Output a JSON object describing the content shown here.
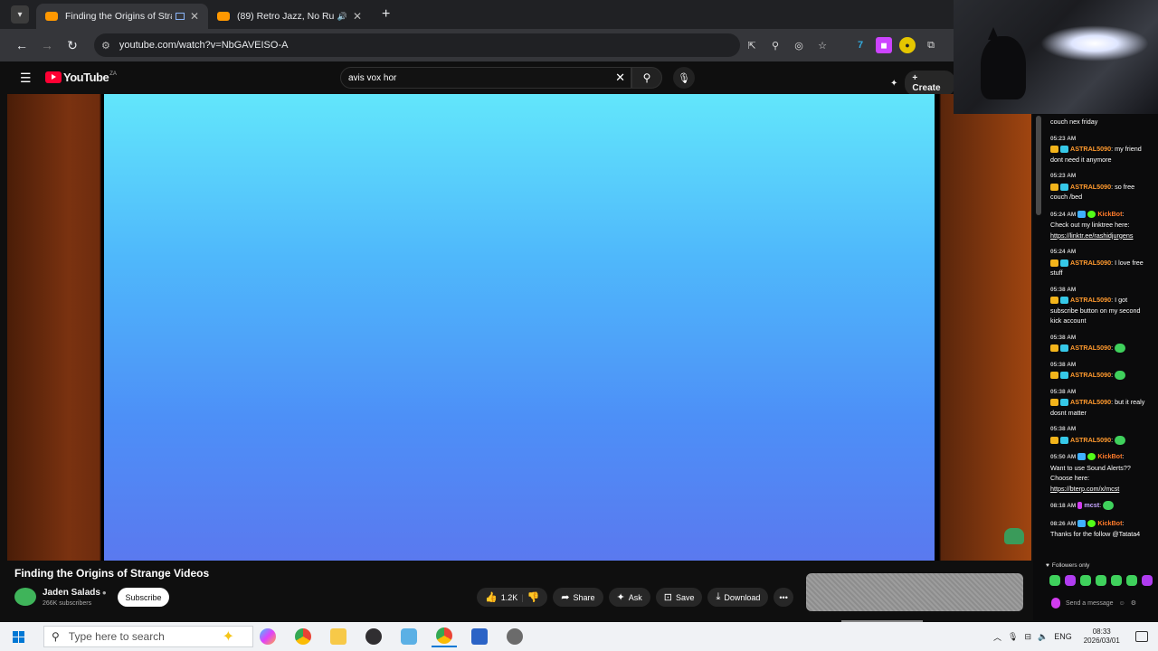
{
  "browser": {
    "tabs": [
      {
        "title": "Finding the Origins of Stran",
        "active": true
      },
      {
        "title": "(89) Retro Jazz, No Rush To",
        "active": false
      }
    ],
    "new_tab": "+",
    "url": "youtube.com/watch?v=NbGAVEISO-A"
  },
  "youtube": {
    "logo_text": "YouTube",
    "logo_region": "ZA",
    "search_query": "avis vox hor",
    "create_label": "Create"
  },
  "video": {
    "title": "Finding the Origins of Strange Videos",
    "channel_name": "Jaden Salads",
    "channel_subs": "266K subscribers",
    "subscribe_label": "Subscribe",
    "like_count": "1.2K",
    "share_label": "Share",
    "ask_label": "Ask",
    "save_label": "Save",
    "download_label": "Download"
  },
  "chat": {
    "top_fragment": "couch nex friday",
    "messages": [
      {
        "time": "05:23 AM",
        "user": "ASTRAL5090",
        "text": "my friend dont need it anymore"
      },
      {
        "time": "05:23 AM",
        "user": "ASTRAL5090",
        "text": "so free couch /bed"
      },
      {
        "time": "05:24 AM",
        "user": "KickBot",
        "text": "Check out my linktree here:",
        "link": "https://linktr.ee/rashidjurgens"
      },
      {
        "time": "05:24 AM",
        "user": "ASTRAL5090",
        "text": "I love free stuff"
      },
      {
        "time": "05:38 AM",
        "user": "ASTRAL5090",
        "text": "I got subscribe button on my second kick account"
      },
      {
        "time": "05:38 AM",
        "user": "ASTRAL5090",
        "text": ""
      },
      {
        "time": "05:38 AM",
        "user": "ASTRAL5090",
        "text": ""
      },
      {
        "time": "05:38 AM",
        "user": "ASTRAL5090",
        "text": "but it realy dosnt matter"
      },
      {
        "time": "05:38 AM",
        "user": "ASTRAL5090",
        "text": ""
      },
      {
        "time": "05:50 AM",
        "user": "KickBot",
        "text": "Want to use Sound Alerts?? Choose here:",
        "link": "https://bterp.com/x/mcst"
      },
      {
        "time": "08:18 AM",
        "user": "mcst",
        "text": ""
      },
      {
        "time": "08:26 AM",
        "user": "KickBot",
        "text": "Thanks for the follow @Tatata4"
      }
    ],
    "followers_only": "Followers only",
    "send_placeholder": "Send a message"
  },
  "taskbar": {
    "search_placeholder": "Type here to search",
    "language": "ENG",
    "time": "08:33",
    "date": "2026/03/01"
  },
  "colors": {
    "youtube_red": "#ff0033",
    "kick_green": "#53fc18",
    "chat_user_orange": "#ff9a2e",
    "video_top": "#62e6fb",
    "video_bottom": "#5a79ef"
  }
}
